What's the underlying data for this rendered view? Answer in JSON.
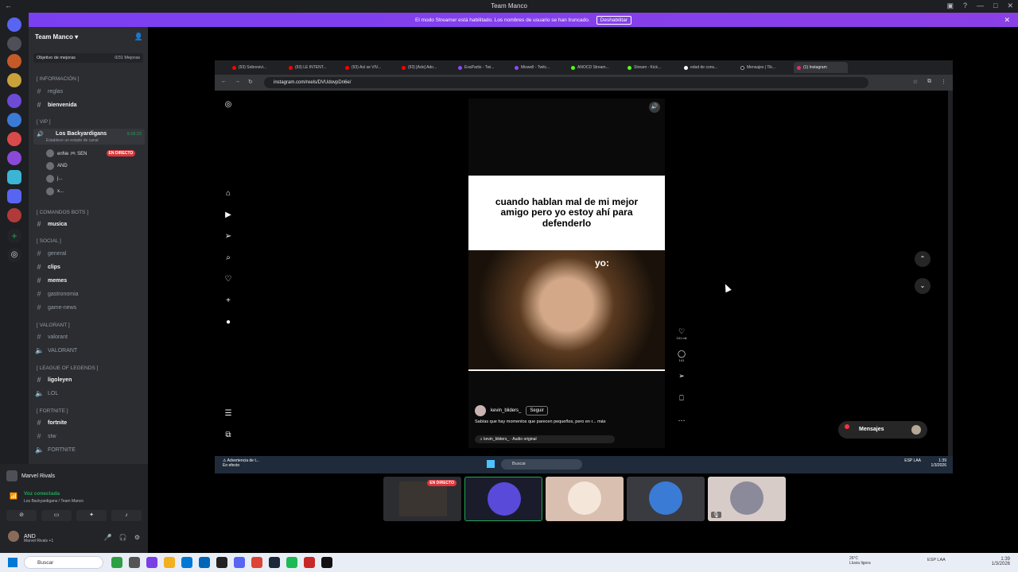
{
  "window": {
    "title": "Team Manco"
  },
  "banner": {
    "text": "El modo Streamer está habilitado. Los nombres de usuario se han truncado.",
    "button": "Deshabilitar"
  },
  "server": {
    "name": "Team Manco",
    "boost_label": "Objetivo de mejoras",
    "boost_progress": "0/31 Mejoras"
  },
  "categories": {
    "info": "[ INFORMACIÓN ]",
    "vip": "[ VIP ]",
    "bots": "[ COMANDOS BOTS ]",
    "social": "[ SOCIAL ]",
    "valorant": "[ VALORANT ]",
    "lol": "[ LEAGUE OF LEGENDS ]",
    "fortnite": "[ FORTNITE ]"
  },
  "channels": {
    "reglas": "reglas",
    "bienvenida": "bienvenida",
    "musica": "musica",
    "general": "general",
    "clips": "clips",
    "memes": "memes",
    "gastronomia": "gastronomia",
    "game_news": "game-news",
    "valorant": "valorant",
    "valorant_voice": "VALORANT",
    "ligoleyen": "ligoleyen",
    "lol_voice": "LOL",
    "fortnite": "fortnite",
    "stw": "stw",
    "fortnite_voice": "FORTNITE"
  },
  "voice": {
    "channel": "Los Backyardigans",
    "status": "Establece un estado de canal",
    "time": "9:18:22",
    "users": [
      "enNe 🎮 SEN",
      "AND",
      "j...",
      "x..."
    ],
    "live_label": "EN DIRECTO"
  },
  "panel": {
    "game": "Marvel Rivals",
    "connected": "Voz conectada",
    "location": "Los Backyardigans / Team Manco",
    "username": "AND",
    "user_status": "Marvel Rivals +1"
  },
  "browser": {
    "tabs": [
      "(93) Sobrevivi...",
      "(93) LE INTENT...",
      "(93) Así se VIV...",
      "(93) [Ado] Ado...",
      "EvaPartis - Twi...",
      "Miswell - Twitc...",
      "ANOCD Stream...",
      "Stream - Kick...",
      "edad de cons...",
      "Mensajes | Tik...",
      "(1) Instagram"
    ],
    "url": "instagram.com/reels/DVUdovpDn6e/"
  },
  "reel": {
    "caption_top": "cuando hablan mal de mi mejor amigo pero yo estoy ahí para defenderlo",
    "overlay": "yo:",
    "author": "kevin_bliders_",
    "follow": "Seguir",
    "caption": "Sabías que hay momentos que parecen pequeños, pero en r... más",
    "audio": "♫ kevin_bliders_ · Audio original",
    "likes": "101 mil",
    "comments": "141"
  },
  "instagram": {
    "messages": "Mensajes"
  },
  "inner_taskbar": {
    "warning": "Advertencia de t...",
    "warning_sub": "En efecto",
    "search": "Buscar",
    "lang": "ESP LAA",
    "time": "1:39",
    "date": "1/3/2026"
  },
  "tiles": {
    "live": "EN DIRECTO"
  },
  "taskbar": {
    "search": "Buscar",
    "weather_temp": "26°C",
    "weather_desc": "Lluvia ligera",
    "lang": "ESP LAA",
    "time": "1:39",
    "date": "1/3/2026"
  },
  "colors": {
    "accent": "#5865f2",
    "live": "#da373c",
    "online": "#23a55a",
    "banner": "#8b3fe6"
  }
}
